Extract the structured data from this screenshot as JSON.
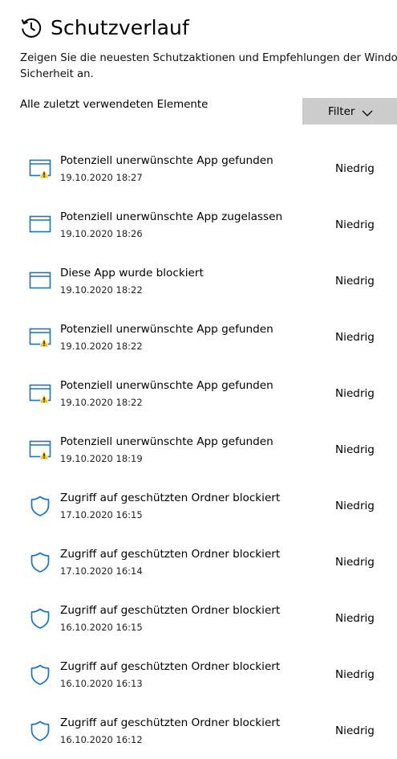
{
  "header": {
    "title": "Schutzverlauf",
    "icon": "history-icon"
  },
  "description": {
    "line1": "Zeigen Sie die neuesten Schutzaktionen und Empfehlungen der Windows",
    "line2": "Sicherheit an."
  },
  "list": {
    "heading": "Alle zuletzt verwendeten Elemente",
    "filter_label": "Filter"
  },
  "colors": {
    "accent": "#1a73c7",
    "warning": "#f7c600",
    "button_bg": "#cccccc"
  },
  "items": [
    {
      "icon": "app-window-warning-icon",
      "title": "Potenziell unerwünschte App gefunden",
      "date": "19.10.2020 18:27",
      "severity": "Niedrig"
    },
    {
      "icon": "app-window-icon",
      "title": "Potenziell unerwünschte App zugelassen",
      "date": "19.10.2020 18:26",
      "severity": "Niedrig"
    },
    {
      "icon": "app-window-icon",
      "title": "Diese App wurde blockiert",
      "date": "19.10.2020 18:22",
      "severity": "Niedrig"
    },
    {
      "icon": "app-window-warning-icon",
      "title": "Potenziell unerwünschte App gefunden",
      "date": "19.10.2020 18:22",
      "severity": "Niedrig"
    },
    {
      "icon": "app-window-warning-icon",
      "title": "Potenziell unerwünschte App gefunden",
      "date": "19.10.2020 18:22",
      "severity": "Niedrig"
    },
    {
      "icon": "app-window-warning-icon",
      "title": "Potenziell unerwünschte App gefunden",
      "date": "19.10.2020 18:19",
      "severity": "Niedrig"
    },
    {
      "icon": "shield-icon",
      "title": "Zugriff auf geschützten Ordner blockiert",
      "date": "17.10.2020 16:15",
      "severity": "Niedrig"
    },
    {
      "icon": "shield-icon",
      "title": "Zugriff auf geschützten Ordner blockiert",
      "date": "17.10.2020 16:14",
      "severity": "Niedrig"
    },
    {
      "icon": "shield-icon",
      "title": "Zugriff auf geschützten Ordner blockiert",
      "date": "16.10.2020 16:15",
      "severity": "Niedrig"
    },
    {
      "icon": "shield-icon",
      "title": "Zugriff auf geschützten Ordner blockiert",
      "date": "16.10.2020 16:13",
      "severity": "Niedrig"
    },
    {
      "icon": "shield-icon",
      "title": "Zugriff auf geschützten Ordner blockiert",
      "date": "16.10.2020 16:12",
      "severity": "Niedrig"
    }
  ]
}
